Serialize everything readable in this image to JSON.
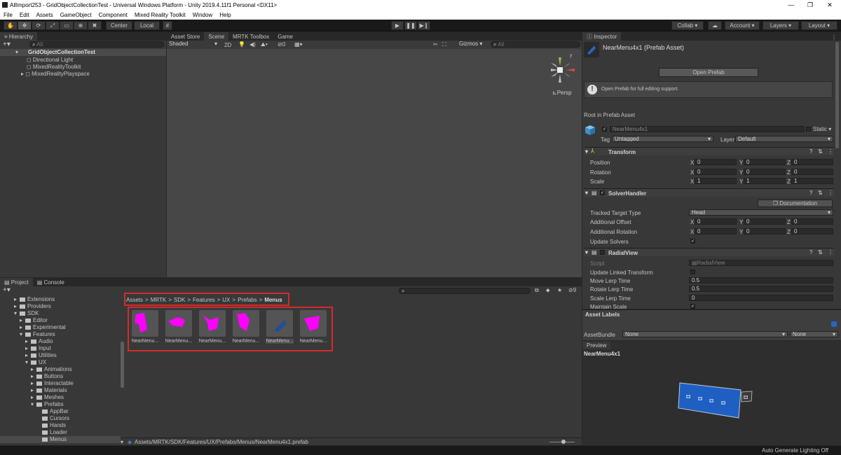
{
  "window": {
    "title": "AllImport253 - GridObjectCollectionTest - Universal Windows Platform - Unity 2019.4.11f1 Personal <DX11>",
    "min": "—",
    "max": "❐",
    "close": "✕"
  },
  "menu": [
    "File",
    "Edit",
    "Assets",
    "GameObject",
    "Component",
    "Mixed Reality Toolkit",
    "Window",
    "Help"
  ],
  "toolbar": {
    "pivot": "Center",
    "space": "Local",
    "collab": "Collab ▾",
    "account": "Account",
    "layers": "Layers",
    "layout": "Layout"
  },
  "hierarchy": {
    "tab": "Hierarchy",
    "search_placeholder": "All",
    "scene": "GridObjectCollectionTest",
    "items": [
      "Directional Light",
      "MixedRealityToolkit",
      "MixedRealityPlayspace"
    ]
  },
  "scene_tabs": [
    "Asset Store",
    "Scene",
    "MRTK Toolbox",
    "Game"
  ],
  "scene": {
    "shading": "Shaded",
    "mode2d": "2D",
    "count": "0",
    "gizmos": "Gizmos",
    "search_placeholder": "All",
    "persp": "Persp"
  },
  "inspector": {
    "tab": "Inspector",
    "asset_title": "NearMenu4x1 (Prefab Asset)",
    "open_prefab": "Open Prefab",
    "info": "Open Prefab for full editing support.",
    "root_label": "Root in Prefab Asset",
    "object_name": "NearMenu4x1",
    "static": "Static",
    "tag_label": "Tag",
    "tag": "Untagged",
    "layer_label": "Layer",
    "layer": "Default",
    "transform": {
      "title": "Transform",
      "rows": [
        {
          "label": "Position",
          "x": "0",
          "y": "0",
          "z": "0"
        },
        {
          "label": "Rotation",
          "x": "0",
          "y": "0",
          "z": "0"
        },
        {
          "label": "Scale",
          "x": "1",
          "y": "1",
          "z": "1"
        }
      ]
    },
    "solver": {
      "title": "SolverHandler",
      "documentation": "Documentation",
      "tracked_label": "Tracked Target Type",
      "tracked": "Head",
      "offset_label": "Additional Offset",
      "offset": {
        "x": "0",
        "y": "0",
        "z": "0"
      },
      "rotation_label": "Additional Rotation",
      "rotation": {
        "x": "0",
        "y": "0",
        "z": "0"
      },
      "update_label": "Update Solvers"
    },
    "radial": {
      "title": "RadialView",
      "script_label": "Script",
      "script": "RadialView",
      "linked_label": "Update Linked Transform",
      "move_label": "Move Lerp Time",
      "move": "0.5",
      "rotate_label": "Rotate Lerp Time",
      "rotate": "0.5",
      "scalelerp_label": "Scale Lerp Time",
      "scalelerp": "0",
      "maintain_label": "Maintain Scale"
    },
    "asset_labels": "Asset Labels",
    "assetbundle_label": "AssetBundle",
    "assetbundle": "None",
    "variant": "None",
    "preview_tab": "Preview",
    "preview_name": "NearMenu4x1"
  },
  "project": {
    "tabs": [
      "Project",
      "Console"
    ],
    "breadcrumb": [
      "Assets",
      "MRTK",
      "SDK",
      "Features",
      "UX",
      "Prefabs",
      "Menus"
    ],
    "hidden_count": "9",
    "tree": [
      {
        "label": "Extensions",
        "d": 2
      },
      {
        "label": "Providers",
        "d": 2
      },
      {
        "label": "SDK",
        "d": 2
      },
      {
        "label": "Editor",
        "d": 3
      },
      {
        "label": "Experimental",
        "d": 3
      },
      {
        "label": "Features",
        "d": 3
      },
      {
        "label": "Audio",
        "d": 4
      },
      {
        "label": "Input",
        "d": 4
      },
      {
        "label": "Utilities",
        "d": 4
      },
      {
        "label": "UX",
        "d": 4
      },
      {
        "label": "Animations",
        "d": 5
      },
      {
        "label": "Buttons",
        "d": 5
      },
      {
        "label": "Interactable",
        "d": 5
      },
      {
        "label": "Materials",
        "d": 5
      },
      {
        "label": "Meshes",
        "d": 5
      },
      {
        "label": "Prefabs",
        "d": 5
      },
      {
        "label": "AppBar",
        "d": 6
      },
      {
        "label": "Cursors",
        "d": 6
      },
      {
        "label": "Hands",
        "d": 6
      },
      {
        "label": "Loader",
        "d": 6
      },
      {
        "label": "Menus",
        "d": 6
      }
    ],
    "assets": [
      "NearMenu...",
      "NearMenu...",
      "NearMenu...",
      "NearMenu...",
      "NearMenu...",
      "NearMenu..."
    ],
    "path": "Assets/MRTK/SDK/Features/UX/Prefabs/Menus/NearMenu4x1.prefab"
  },
  "status": "Auto Generate Lighting Off",
  "colors": {
    "highlight": "#d52b2b",
    "magenta": "#ff00ff",
    "selected_blue": "#1f4e9e"
  }
}
